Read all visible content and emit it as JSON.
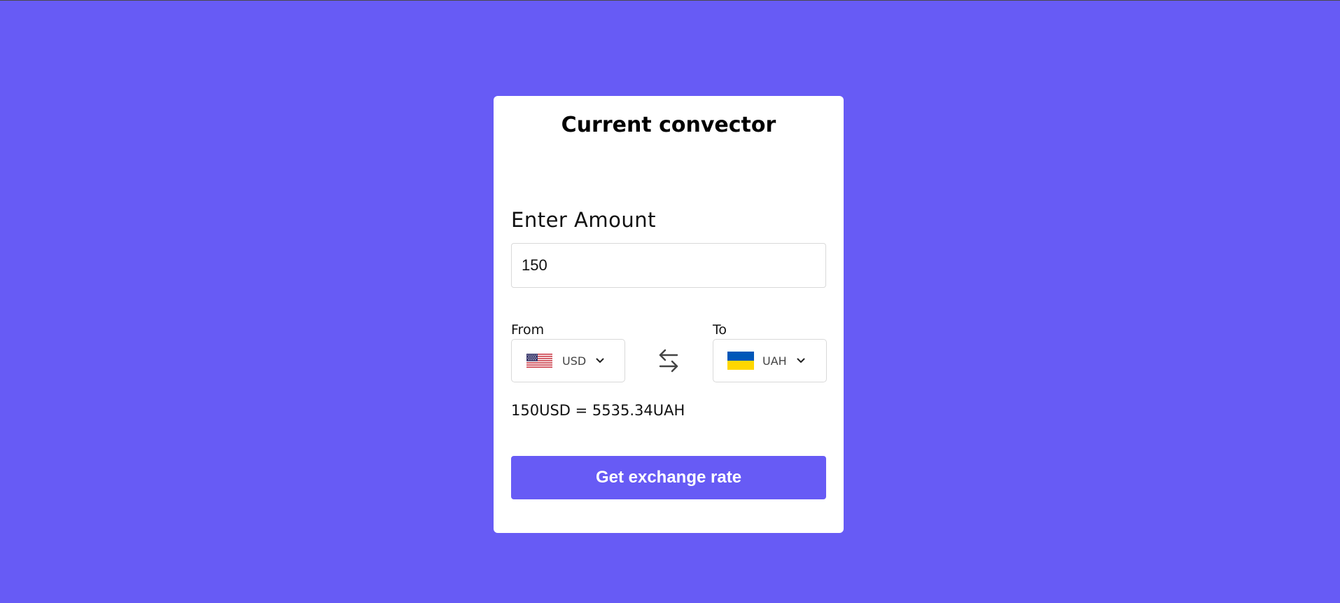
{
  "converter": {
    "title": "Current convector",
    "amount_label": "Enter Amount",
    "amount_value": "150",
    "from_label": "From",
    "to_label": "To",
    "from_currency": {
      "code": "USD",
      "flag_icon": "us-flag-icon"
    },
    "to_currency": {
      "code": "UAH",
      "flag_icon": "ua-flag-icon"
    },
    "result_text": "150USD = 5535.34UAH",
    "button_label": "Get exchange rate"
  },
  "colors": {
    "background": "#675bf5",
    "card": "#ffffff",
    "button": "#675bf5",
    "ua_blue": "#0057b8",
    "ua_yellow": "#ffd700"
  }
}
